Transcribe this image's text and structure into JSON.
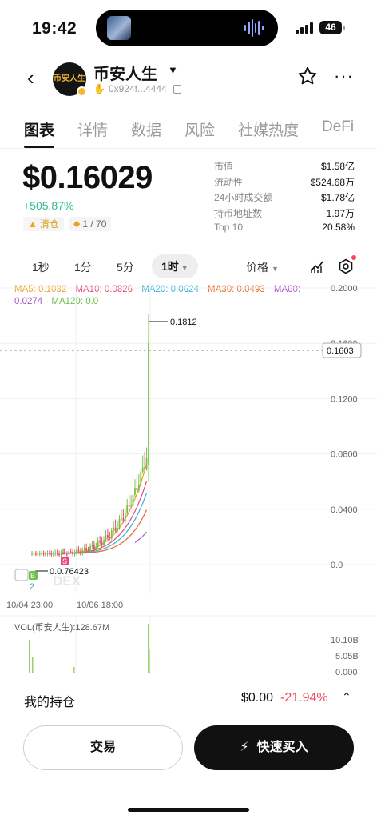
{
  "status_bar": {
    "time": "19:42",
    "battery": "46"
  },
  "header": {
    "avatar_text": "币安人生",
    "token_name": "币安人生",
    "address": "0x924f...4444"
  },
  "tabs": [
    "图表",
    "详情",
    "数据",
    "风险",
    "社媒热度",
    "DeFi"
  ],
  "price": {
    "value": "$0.16029",
    "change": "+505.87%",
    "tag_clear": "清仓",
    "tag_rank": "1 / 70"
  },
  "stats": [
    {
      "label": "市值",
      "value": "$1.58亿"
    },
    {
      "label": "流动性",
      "value": "$524.68万"
    },
    {
      "label": "24小时成交额",
      "value": "$1.78亿"
    },
    {
      "label": "持币地址数",
      "value": "1.97万"
    },
    {
      "label": "Top 10",
      "value": "20.58%"
    }
  ],
  "intervals": [
    "1秒",
    "1分",
    "5分",
    "1时"
  ],
  "price_selector": "价格",
  "ma": [
    {
      "label": "MA5: 0.1032",
      "color": "#f0a020"
    },
    {
      "label": "MA10: 0.0826",
      "color": "#e8497a"
    },
    {
      "label": "MA20: 0.0624",
      "color": "#2bb3d9"
    },
    {
      "label": "MA30: 0.0493",
      "color": "#e86a2a"
    },
    {
      "label": "MA60: 0.0274",
      "color": "#a855c8"
    },
    {
      "label": "MA120: 0.0",
      "color": "#6cc04a"
    }
  ],
  "chart_data": {
    "type": "candlestick",
    "y_ticks": [
      "0.2000",
      "0.1600",
      "0.1200",
      "0.0800",
      "0.0400",
      "0.0"
    ],
    "ylim": [
      0,
      0.2
    ],
    "x_ticks": [
      "10/04 23:00",
      "10/06 18:00"
    ],
    "high_label": "0.1812",
    "low_label": "0.0.76423",
    "current_price": "0.1603",
    "current": 0.1603,
    "high": 0.1812,
    "marker_s": "S",
    "marker_s_count": "1",
    "marker_b": "B",
    "marker_b_count": "2",
    "watermark": "DEX",
    "vol_label": "VOL(币安人生):128.67M",
    "vol_ticks": [
      "10.10B",
      "5.05B",
      "0.000"
    ]
  },
  "holding": {
    "label": "我的持仓",
    "value": "$0.00",
    "pct": "-21.94%"
  },
  "buttons": {
    "trade": "交易",
    "quick_buy": "快速买入"
  }
}
